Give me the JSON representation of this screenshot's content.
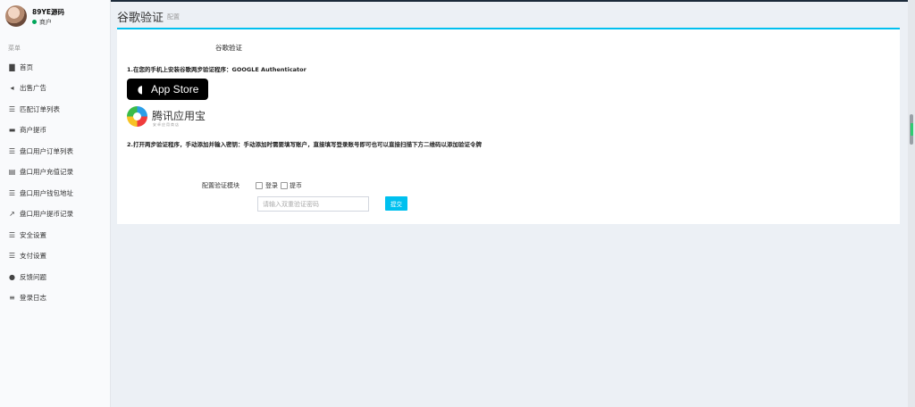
{
  "user": {
    "name": "89YE源码",
    "status": "商户"
  },
  "sidebar": {
    "header": "菜单",
    "items": [
      {
        "icon": "bar-chart-icon",
        "label": "首页"
      },
      {
        "icon": "bullhorn-icon",
        "label": "出售广告"
      },
      {
        "icon": "list-icon",
        "label": "匹配订单列表"
      },
      {
        "icon": "credit-card-icon",
        "label": "商户提币"
      },
      {
        "icon": "list-icon",
        "label": "盘口用户订单列表"
      },
      {
        "icon": "clipboard-icon",
        "label": "盘口用户充值记录"
      },
      {
        "icon": "list-icon",
        "label": "盘口用户钱包地址"
      },
      {
        "icon": "external-link-icon",
        "label": "盘口用户提币记录"
      },
      {
        "icon": "list-icon",
        "label": "安全设置"
      },
      {
        "icon": "list-icon",
        "label": "支付设置"
      },
      {
        "icon": "comment-icon",
        "label": "反馈问题"
      },
      {
        "icon": "list-ol-icon",
        "label": "登录日志"
      }
    ]
  },
  "page": {
    "title": "谷歌验证",
    "subtitle": "配置"
  },
  "card": {
    "title": "谷歌验证",
    "step1": "1.在您的手机上安装谷歌两步验证程序：GOOGLE Authenticator",
    "appstore_label": "App Store",
    "tencent_name": "腾讯应用宝",
    "tencent_tag": "安卓应用商店",
    "step2": "2.打开两步验证程序，手动添加并输入密钥：手动添加时需要填写账户，直接填写登录账号即可也可以直接扫描下方二维码以添加验证令牌",
    "module_label": "配置验证模块",
    "checkbox_login": "登录",
    "checkbox_withdraw": "提币",
    "input_placeholder": "请输入双重验证密码",
    "submit_label": "提交"
  }
}
